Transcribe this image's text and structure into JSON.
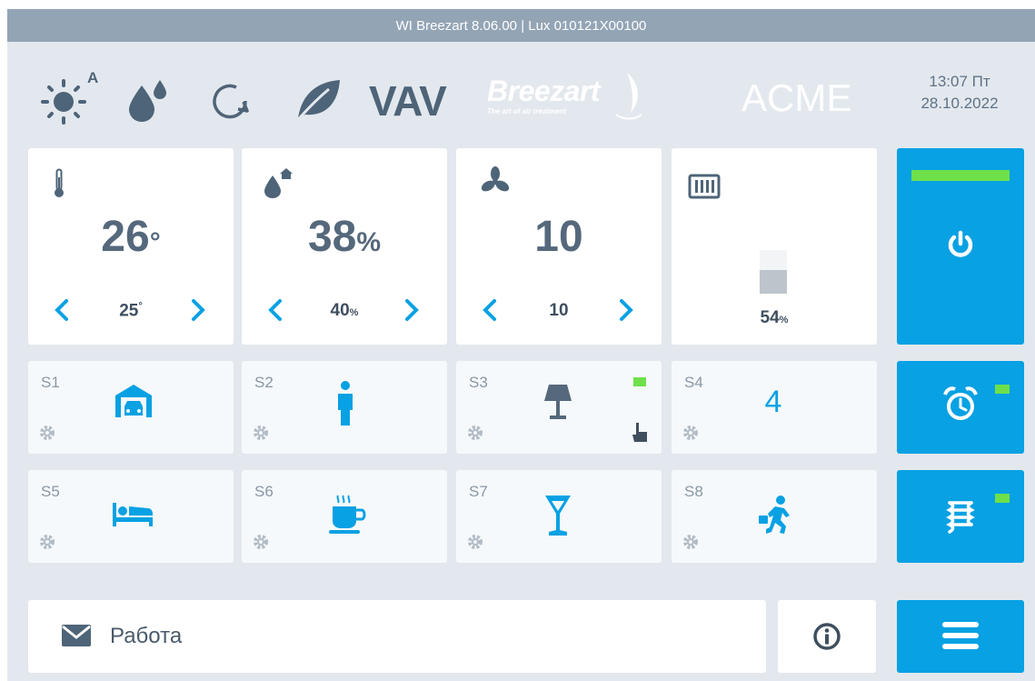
{
  "titlebar": {
    "text": "WI Breezart 8.06.00 | Lux 010121X00100"
  },
  "header": {
    "auto_mark": "A",
    "mode_label": "VAV",
    "brand": {
      "name": "Breezart",
      "tagline": "The art of air treatment"
    },
    "company": "ACME",
    "time": "13:07 Пт",
    "date": "28.10.2022"
  },
  "tiles": {
    "temperature": {
      "value": "26",
      "unit": "°",
      "setpoint": "25",
      "setpoint_unit": "°"
    },
    "humidity": {
      "value": "38",
      "unit": "%",
      "setpoint": "40",
      "setpoint_unit": "%"
    },
    "fan": {
      "value": "10",
      "setpoint": "10"
    },
    "heater": {
      "level_value": "54",
      "level_unit": "%",
      "level_fraction": 0.54
    }
  },
  "sensors": [
    {
      "label": "S1",
      "icon": "garage-icon"
    },
    {
      "label": "S2",
      "icon": "person-icon"
    },
    {
      "label": "S3",
      "icon": "lamp-icon"
    },
    {
      "label": "S4",
      "value": "4"
    },
    {
      "label": "S5",
      "icon": "bed-icon"
    },
    {
      "label": "S6",
      "icon": "coffee-cup-icon"
    },
    {
      "label": "S7",
      "icon": "cocktail-glass-icon"
    },
    {
      "label": "S8",
      "icon": "running-man-icon"
    }
  ],
  "message": {
    "text": "Работа"
  },
  "colors": {
    "accent": "#08a1e3",
    "indicator_green": "#6ee04a",
    "text_dark": "#4e6478",
    "background": "#e3e8ee"
  }
}
